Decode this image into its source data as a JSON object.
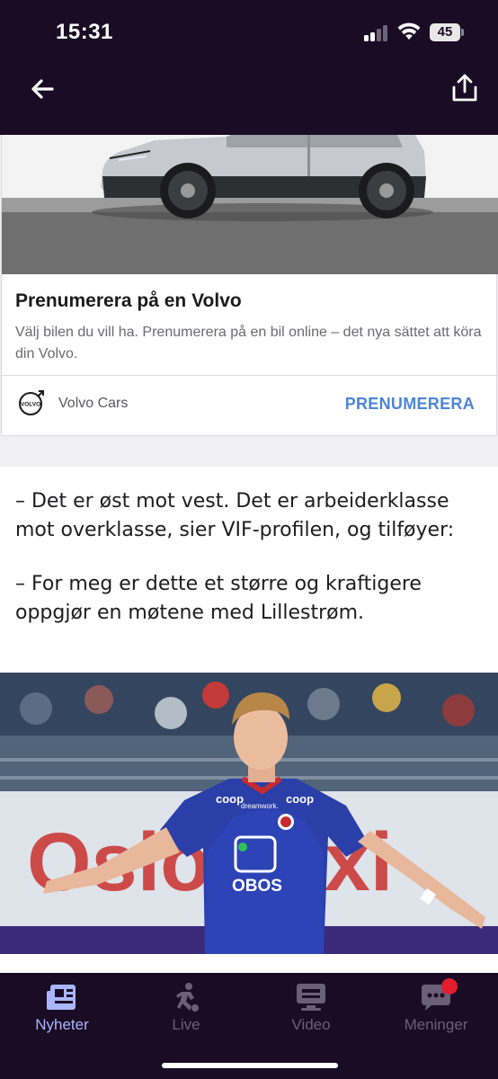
{
  "status": {
    "time": "15:31",
    "battery": "45"
  },
  "ad": {
    "title": "Prenumerera på en Volvo",
    "description": "Välj bilen du vill ha. Prenumerera på en bil online – det nya sättet att köra din Volvo.",
    "brand": "Volvo Cars",
    "cta": "PRENUMERERA",
    "logo_text": "VOLVO"
  },
  "article": {
    "paragraphs": [
      "– Det er øst mot vest. Det er arbeiderklasse mot overklasse, sier VIF-profilen, og tilføyer:",
      "– For meg er dette et større og kraftigere oppgjør en møtene med Lillestrøm."
    ],
    "photo": {
      "shirt_logos": [
        "coop",
        "dreamwork.",
        "coop",
        "OBOS"
      ],
      "banner_text": "Oslo Taxi"
    }
  },
  "tabs": [
    {
      "label": "Nyheter",
      "icon": "newspaper-icon",
      "active": true
    },
    {
      "label": "Live",
      "icon": "soccer-player-icon",
      "active": false
    },
    {
      "label": "Video",
      "icon": "tv-icon",
      "active": false
    },
    {
      "label": "Meninger",
      "icon": "chat-bubble-icon",
      "active": false
    }
  ],
  "colors": {
    "header_bg": "#1a0c24",
    "accent": "#a9b6ff",
    "cta_blue": "#4e86d6",
    "notification": "#e11d2e"
  }
}
